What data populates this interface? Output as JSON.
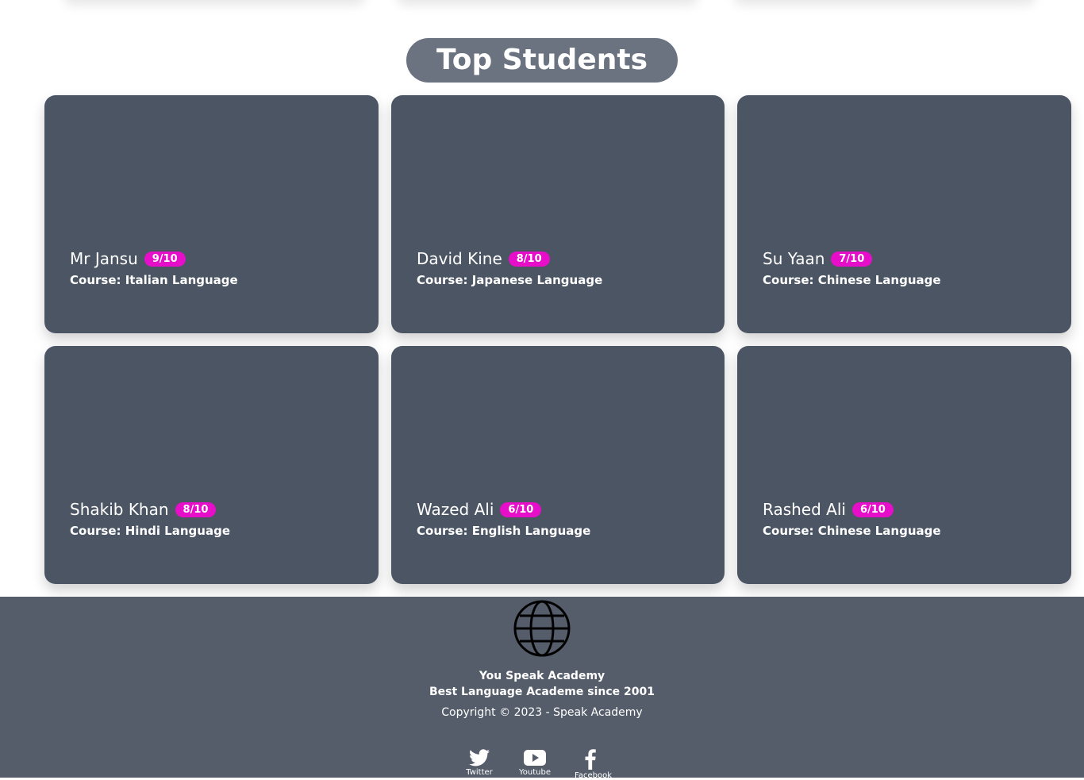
{
  "section": {
    "title": "Top Students"
  },
  "students": [
    {
      "name": "Mr Jansu",
      "score": "9/10",
      "course": "Course: Italian Language"
    },
    {
      "name": "David Kine",
      "score": "8/10",
      "course": "Course: Japanese Language"
    },
    {
      "name": "Su Yaan",
      "score": "7/10",
      "course": "Course: Chinese Language"
    },
    {
      "name": "Shakib Khan",
      "score": "8/10",
      "course": "Course: Hindi Language"
    },
    {
      "name": "Wazed Ali",
      "score": "6/10",
      "course": "Course: English Language"
    },
    {
      "name": "Rashed Ali",
      "score": "6/10",
      "course": "Course: Chinese Language"
    }
  ],
  "footer": {
    "logo_icon": "globe-icon",
    "academy_name": "You Speak Academy",
    "tagline": "Best Language Academe since 2001",
    "copyright": "Copyright © 2023 - Speak Academy",
    "socials": [
      {
        "icon": "twitter-icon",
        "label": "Twitter"
      },
      {
        "icon": "youtube-icon",
        "label": "Youtube"
      },
      {
        "icon": "facebook-icon",
        "label": "Facebook"
      }
    ]
  },
  "colors": {
    "card_bg": "#4b5563",
    "badge_bg": "#e60ec8",
    "title_pill_bg": "#6b7280",
    "footer_bg": "#555d6b"
  }
}
